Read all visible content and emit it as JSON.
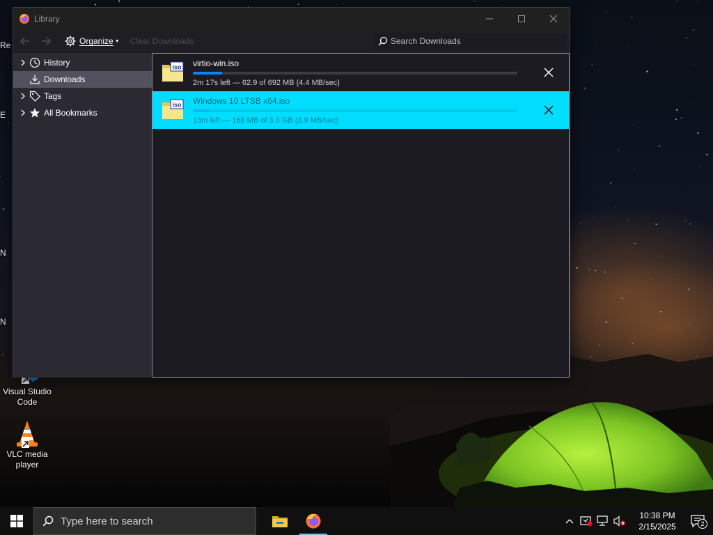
{
  "desktop": {
    "icons": [
      {
        "name": "visual-studio-code",
        "label": "Visual Studio Code"
      },
      {
        "name": "vlc-media-player",
        "label": "VLC media player"
      }
    ],
    "edge_letters": [
      "Re",
      "E",
      "N",
      "N"
    ]
  },
  "window": {
    "title": "Library",
    "controls": {
      "minimize": "minimize",
      "maximize": "maximize",
      "close": "close"
    }
  },
  "toolbar": {
    "back_icon": "back-arrow-icon",
    "forward_icon": "forward-arrow-icon",
    "organize_label": "Organize",
    "clear_label": "Clear Downloads",
    "search_placeholder": "Search Downloads"
  },
  "sidebar": {
    "items": [
      {
        "label": "History",
        "icon": "clock-icon",
        "expandable": true
      },
      {
        "label": "Downloads",
        "icon": "download-icon",
        "expandable": false,
        "selected": true
      },
      {
        "label": "Tags",
        "icon": "tag-icon",
        "expandable": true
      },
      {
        "label": "All Bookmarks",
        "icon": "star-icon",
        "expandable": true
      }
    ]
  },
  "downloads": [
    {
      "filename": "virtio-win.iso",
      "status": "2m 17s left — 62.9 of 692 MB (4.4 MB/sec)",
      "progress": 0.09,
      "selected": false
    },
    {
      "filename": "Windows 10 LTSB x64.iso",
      "status": "13m left — 168 MB of 3.3 GB (3.9 MB/sec)",
      "progress": 0.05,
      "selected": true
    }
  ],
  "taskbar": {
    "search_placeholder": "Type here to search",
    "pinned": [
      "file-explorer",
      "firefox"
    ],
    "clock_time": "10:38 PM",
    "clock_date": "2/15/2025",
    "notifications_count": "2"
  },
  "colors": {
    "accent": "#0a84ff",
    "selection": "#00ddff",
    "window_bg": "#2b2a33",
    "list_bg": "#1c1b22",
    "taskbar_bg": "#101010"
  }
}
